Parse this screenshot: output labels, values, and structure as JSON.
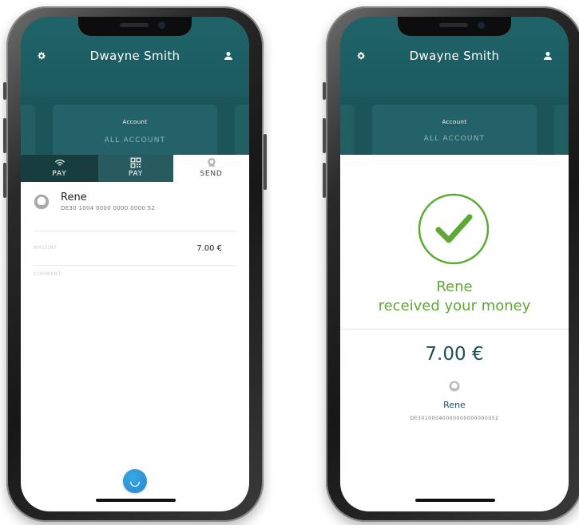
{
  "colors": {
    "teal_dark": "#1c5d62",
    "success_green": "#5ea933",
    "fab_blue": "#2b8fd3",
    "amount_text": "#1f4f57"
  },
  "left_screen": {
    "header": {
      "user_name": "Dwayne Smith",
      "settings_icon": "gear-icon",
      "profile_icon": "user-icon"
    },
    "account_card": {
      "label": "Account",
      "value": "ALL ACCOUNT"
    },
    "tabs": [
      {
        "label": "PAY",
        "icon": "nfc-wave-icon",
        "selected": false
      },
      {
        "label": "PAY",
        "icon": "qr-code-icon",
        "selected": false
      },
      {
        "label": "SEND",
        "icon": "user-icon",
        "selected": true
      }
    ],
    "recipient": {
      "name": "Rene",
      "iban": "DE30 1004 0000 0000 0000 52"
    },
    "form": {
      "amount_label": "AMOUNT",
      "amount_value": "7.00 €",
      "comment_label": "COMMENT"
    },
    "fab_icon": "spinner-icon"
  },
  "right_screen": {
    "header": {
      "user_name": "Dwayne Smith",
      "settings_icon": "gear-icon",
      "profile_icon": "user-icon"
    },
    "account_card": {
      "label": "Account",
      "value": "ALL ACCOUNT"
    },
    "success": {
      "icon": "checkmark-icon",
      "line1": "Rene",
      "line2": "received your money",
      "amount": "7.00 €",
      "recipient_name": "Rene",
      "recipient_iban": "DE30100040000000000000052"
    }
  }
}
